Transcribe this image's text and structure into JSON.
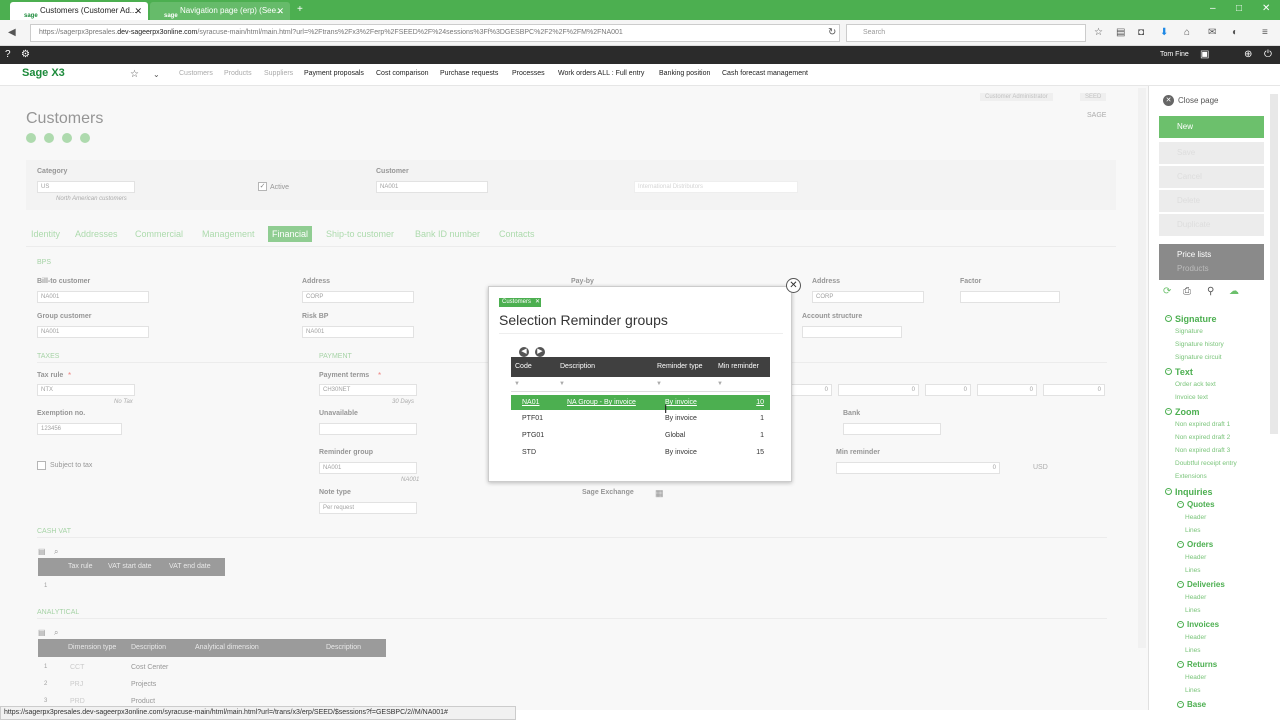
{
  "browser": {
    "tabs": [
      {
        "badge": "sage",
        "label": "Customers (Customer Ad...",
        "active": true
      },
      {
        "badge": "sage",
        "label": "Navigation page (erp) (See...",
        "active": false
      }
    ],
    "new_tab": "+",
    "url_prefix": "https://sagerpx3presales.",
    "url_host": "dev-sageerpx3online.com",
    "url_rest": "/syracuse-main/html/main.html?url=%2Ftrans%2Fx3%2Ferp%2FSEED%2F%24sessions%3Ff%3DGESBPC%2F2%2F%2FM%2FNA001",
    "search_placeholder": "Search",
    "window_controls": [
      "–",
      "□",
      "✕"
    ]
  },
  "topbar": {
    "user": "Tom Fine"
  },
  "menu": {
    "logo": "Sage X3",
    "items": [
      {
        "label": "Customers",
        "dim": true
      },
      {
        "label": "Products",
        "dim": true
      },
      {
        "label": "Suppliers",
        "dim": true
      },
      {
        "label": "Payment proposals",
        "dim": false
      },
      {
        "label": "Cost comparison",
        "dim": false
      },
      {
        "label": "Purchase requests",
        "dim": false
      },
      {
        "label": "Processes",
        "dim": false
      },
      {
        "label": "Work orders ALL : Full entry",
        "dim": false
      },
      {
        "label": "Banking position",
        "dim": false
      },
      {
        "label": "Cash forecast management",
        "dim": false
      }
    ]
  },
  "page": {
    "title": "Customers",
    "role": "Customer Administrator",
    "folder": "SEED",
    "company": "SAGE",
    "category_label": "Category",
    "category_value": "US",
    "category_desc": "North American customers",
    "active_label": "Active",
    "customer_label": "Customer",
    "customer_value": "NA001",
    "customer_name": "International Distributors",
    "tabs": [
      "Identity",
      "Addresses",
      "Commercial",
      "Management",
      "Financial",
      "Ship-to customer",
      "Bank ID number",
      "Contacts"
    ],
    "sections": {
      "bps": "BPS",
      "taxes": "TAXES",
      "payment": "PAYMENT",
      "cashvat": "CASH VAT",
      "analytical": "ANALYTICAL"
    },
    "fields": {
      "bill_to_label": "Bill-to customer",
      "bill_to_value": "NA001",
      "address_label": "Address",
      "address_value": "CORP",
      "pay_by_label": "Pay-by",
      "address2_label": "Address",
      "address2_value": "CORP",
      "factor_label": "Factor",
      "group_label": "Group customer",
      "group_value": "NA001",
      "risk_label": "Risk BP",
      "risk_value": "NA001",
      "account_structure_label": "Account structure",
      "tax_rule_label": "Tax rule",
      "tax_rule_value": "NTX",
      "tax_rule_desc": "No Tax",
      "payment_terms_label": "Payment terms",
      "payment_terms_value": "CH30NET",
      "payment_terms_desc": "30 Days",
      "exemption_label": "Exemption no.",
      "exemption_value": "123456",
      "unavailable_label": "Unavailable",
      "bank_label": "Bank",
      "subject_tax_label": "Subject to tax",
      "reminder_group_label": "Reminder group",
      "reminder_group_value": "NA001",
      "reminder_group_desc": "NA001",
      "min_reminder_label": "Min reminder",
      "min_reminder_value": "0",
      "min_reminder_currency": "USD",
      "note_type_label": "Note type",
      "note_type_value": "Per request",
      "sage_exchange_label": "Sage Exchange",
      "zero": "0"
    },
    "cashvat_grid": {
      "headers": [
        "Tax rule",
        "VAT start date",
        "VAT end date"
      ],
      "rows": [
        "1"
      ]
    },
    "analytical_grid": {
      "headers": [
        "Dimension type",
        "Description",
        "Analytical dimension",
        "Description"
      ],
      "rows": [
        {
          "n": "1",
          "type": "CCT",
          "desc": "Cost Center"
        },
        {
          "n": "2",
          "type": "PRJ",
          "desc": "Projects"
        },
        {
          "n": "3",
          "type": "PRD",
          "desc": "Product"
        }
      ]
    }
  },
  "modal": {
    "crumb": "Customers",
    "title": "Selection Reminder groups",
    "headers": {
      "code": "Code",
      "description": "Description",
      "type": "Reminder type",
      "min": "Min reminder"
    },
    "rows": [
      {
        "code": "NA01",
        "description": "NA Group - By invoice",
        "type": "By invoice",
        "min": "10",
        "selected": true
      },
      {
        "code": "PTF01",
        "description": "",
        "type": "By invoice",
        "min": "1",
        "selected": false
      },
      {
        "code": "PTG01",
        "description": "",
        "type": "Global",
        "min": "1",
        "selected": false
      },
      {
        "code": "STD",
        "description": "",
        "type": "By invoice",
        "min": "15",
        "selected": false
      }
    ]
  },
  "right_panel": {
    "close": "Close page",
    "new": "New",
    "disabled": [
      "Save",
      "Cancel",
      "Delete",
      "Duplicate"
    ],
    "price_lists": "Price lists",
    "products": "Products",
    "groups": [
      {
        "title": "Signature",
        "links": [
          "Signature",
          "Signature history",
          "Signature circuit"
        ]
      },
      {
        "title": "Text",
        "links": [
          "Order ack text",
          "Invoice text"
        ]
      },
      {
        "title": "Zoom",
        "links": [
          "Non expired draft 1",
          "Non expired draft 2",
          "Non expired draft 3",
          "Doubtful receipt entry",
          "Extensions"
        ]
      }
    ],
    "inquiries": "Inquiries",
    "inquiry_groups": [
      {
        "title": "Quotes",
        "links": [
          "Header",
          "Lines"
        ]
      },
      {
        "title": "Orders",
        "links": [
          "Header",
          "Lines"
        ]
      },
      {
        "title": "Deliveries",
        "links": [
          "Header",
          "Lines"
        ]
      },
      {
        "title": "Invoices",
        "links": [
          "Header",
          "Lines"
        ]
      },
      {
        "title": "Returns",
        "links": [
          "Header",
          "Lines"
        ]
      },
      {
        "title": "Base",
        "links": []
      }
    ]
  },
  "status_bar": "https://sagerpx3presales.dev-sageerpx3online.com/syracuse-main/html/main.html?url=/trans/x3/erp/SEED/$sessions?f=GESBPC/2//M/NA001#"
}
